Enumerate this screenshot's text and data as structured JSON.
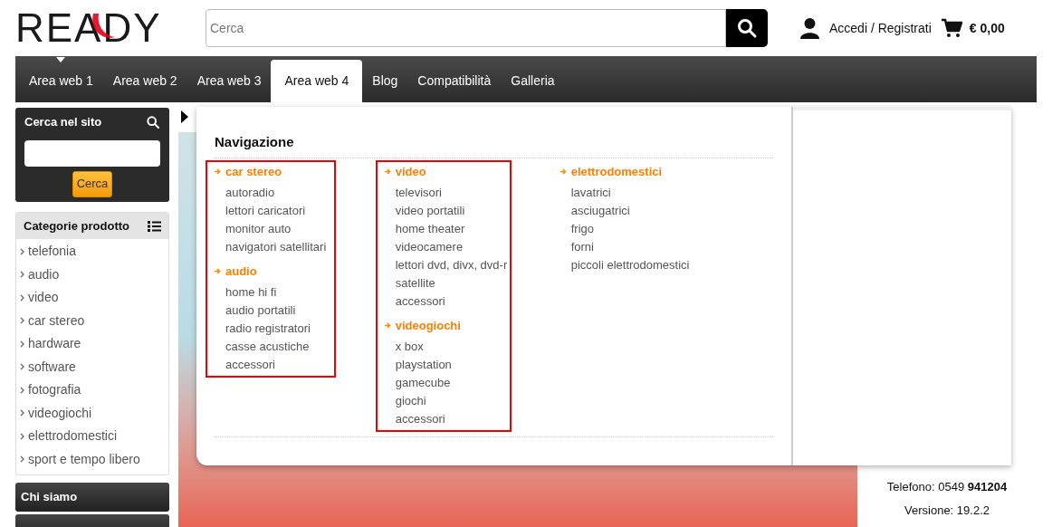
{
  "header": {
    "logo": "READY",
    "search": {
      "placeholder": "Cerca"
    },
    "account": "Accedi / Registrati",
    "cart_total": "€ 0,00"
  },
  "nav": [
    {
      "label": "Area web 1",
      "selected": false,
      "hovered": true
    },
    {
      "label": "Area web 2",
      "selected": false,
      "hovered": false
    },
    {
      "label": "Area web 3",
      "selected": false,
      "hovered": false
    },
    {
      "label": "Area web 4",
      "selected": true,
      "hovered": false
    },
    {
      "label": "Blog",
      "selected": false,
      "hovered": false
    },
    {
      "label": "Compatibilità",
      "selected": false,
      "hovered": false
    },
    {
      "label": "Galleria",
      "selected": false,
      "hovered": false
    }
  ],
  "sidebar": {
    "site_search": {
      "title": "Cerca nel sito",
      "button": "Cerca"
    },
    "categories": {
      "title": "Categorie prodotto",
      "items": [
        "telefonia",
        "audio",
        "video",
        "car stereo",
        "hardware",
        "software",
        "fotografia",
        "videogiochi",
        "elettrodomestici",
        "sport e tempo libero"
      ]
    },
    "links": [
      "Chi siamo"
    ]
  },
  "mega_menu": {
    "title": "Navigazione",
    "columns": [
      {
        "highlighted": true,
        "groups": [
          {
            "title": "car stereo",
            "items": [
              "autoradio",
              "lettori caricatori",
              "monitor auto",
              "navigatori satellitari"
            ]
          },
          {
            "title": "audio",
            "items": [
              "home hi fi",
              "audio portatili",
              "radio registratori",
              "casse acustiche",
              "accessori"
            ]
          }
        ]
      },
      {
        "highlighted": true,
        "groups": [
          {
            "title": "video",
            "items": [
              "televisori",
              "video portatili",
              "home theater",
              "videocamere",
              "lettori dvd, divx, dvd-r",
              "satellite",
              "accessori"
            ]
          },
          {
            "title": "videogiochi",
            "items": [
              "x box",
              "playstation",
              "gamecube",
              "giochi",
              "accessori"
            ]
          }
        ]
      },
      {
        "highlighted": false,
        "groups": [
          {
            "title": "elettrodomestici",
            "items": [
              "lavatrici",
              "asciugatrici",
              "frigo",
              "forni",
              "piccoli elettrodomestici"
            ]
          }
        ]
      }
    ]
  },
  "info": [
    "Telefono: 0549 **941204**",
    "Versione: 19.2.2"
  ]
}
